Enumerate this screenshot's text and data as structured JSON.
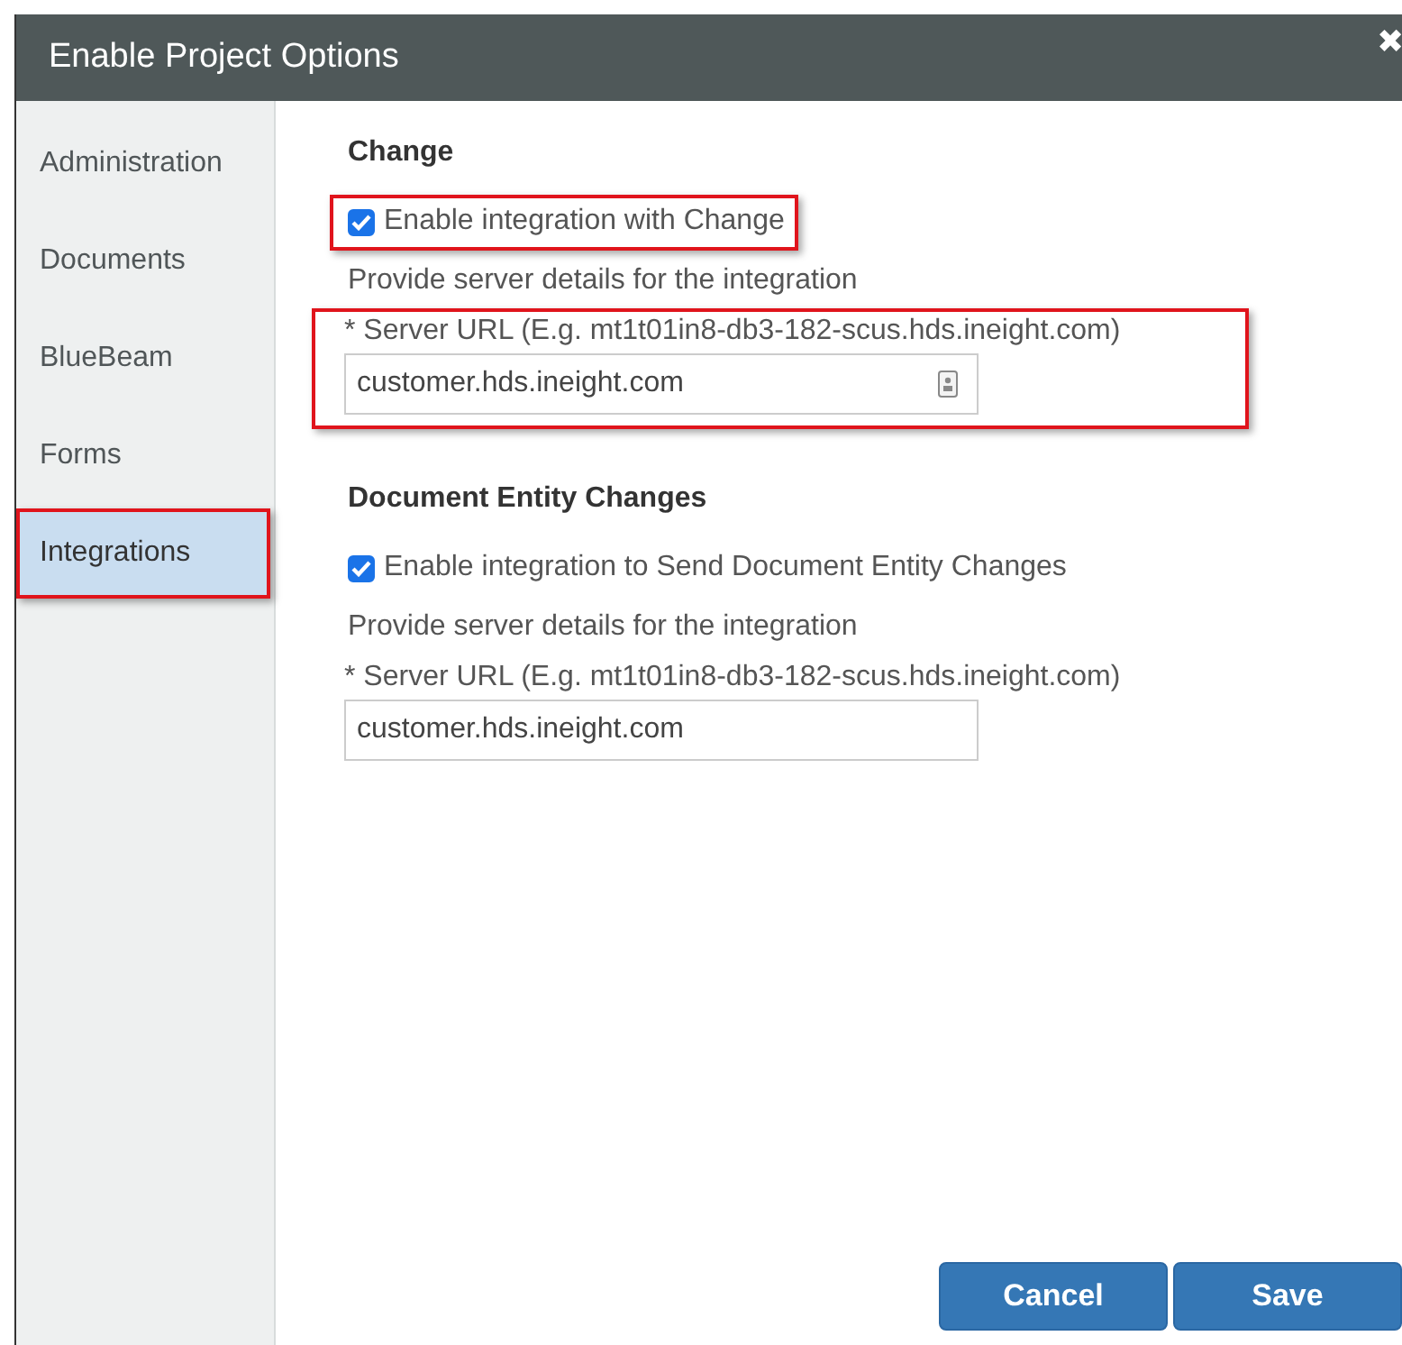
{
  "window": {
    "title": "Enable Project Options",
    "close": "✖"
  },
  "sidebar": {
    "items": [
      {
        "label": "Administration",
        "selected": false,
        "highlighted": false
      },
      {
        "label": "Documents",
        "selected": false,
        "highlighted": false
      },
      {
        "label": "BlueBeam",
        "selected": false,
        "highlighted": false
      },
      {
        "label": "Forms",
        "selected": false,
        "highlighted": false
      },
      {
        "label": "Integrations",
        "selected": true,
        "highlighted": true
      }
    ]
  },
  "sections": [
    {
      "heading": "Change",
      "checkbox": {
        "label": "Enable integration with Change",
        "checked": true,
        "highlighted": true
      },
      "hint": "Provide server details for the integration",
      "field": {
        "label": "* Server URL (E.g. mt1t01in8-db3-182-scus.hds.ineight.com)",
        "value": "customer.hds.ineight.com",
        "has_icon": true,
        "highlighted": true
      }
    },
    {
      "heading": "Document Entity Changes",
      "checkbox": {
        "label": "Enable integration to Send Document Entity Changes",
        "checked": true,
        "highlighted": false
      },
      "hint": "Provide server details for the integration",
      "field": {
        "label": "* Server URL (E.g. mt1t01in8-db3-182-scus.hds.ineight.com)",
        "value": "customer.hds.ineight.com",
        "has_icon": false,
        "highlighted": false
      }
    }
  ],
  "buttons": [
    "Cancel",
    "Save"
  ]
}
